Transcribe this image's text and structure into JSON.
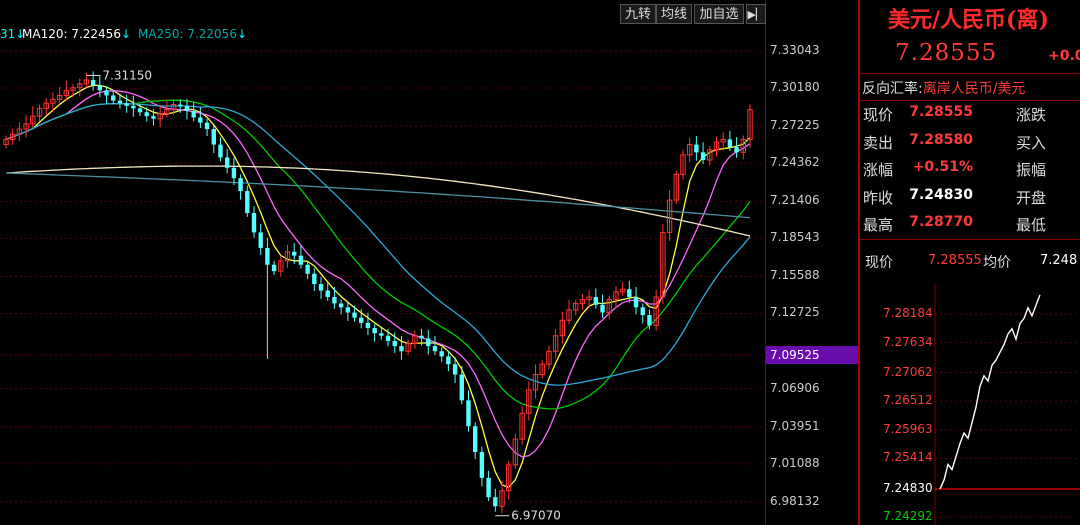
{
  "toolbar": {
    "nine_turn_label": "九转",
    "ma_label": "均线",
    "add_watch_label": "加自选",
    "collapse_icon": "right-collapse-icon"
  },
  "ma_legend": {
    "ma_partial_prefix": "31",
    "ma_partial_arrow": "↓",
    "ma120_label": "MA120: 7.22456",
    "ma120_arrow": "↓",
    "ma250_label": "MA250: 7.22056",
    "ma250_arrow": "↓",
    "colors": {
      "ma_partial": "#00ffff",
      "ma120": "#ffffff",
      "ma250": "#00aaaa"
    }
  },
  "axis": {
    "price_levels": [
      "7.33043",
      "7.30180",
      "7.27225",
      "7.24362",
      "7.21406",
      "7.18543",
      "7.15588",
      "7.12725",
      "7.09525",
      "7.06906",
      "7.03951",
      "7.01088",
      "6.98132"
    ],
    "highlight_level": "7.09525",
    "highlight_color": "#6a0dad"
  },
  "annotations": {
    "high": "7.31150",
    "low": "6.97070"
  },
  "quote": {
    "title": "美元/人民币(离)",
    "price": "7.28555",
    "change": "+0.0",
    "reverse_rate_label": "反向汇率:",
    "reverse_rate_value": "离岸人民币/美元",
    "rows": [
      {
        "label": "现价",
        "value": "7.28555",
        "label2": "涨跌",
        "white": false
      },
      {
        "label": "卖出",
        "value": "7.28580",
        "label2": "买入",
        "white": false
      },
      {
        "label": "涨幅",
        "value": "+0.51%",
        "label2": "振幅",
        "white": false
      },
      {
        "label": "昨收",
        "value": "7.24830",
        "label2": "开盘",
        "white": true
      },
      {
        "label": "最高",
        "value": "7.28770",
        "label2": "最低",
        "white": false
      }
    ]
  },
  "intraday": {
    "price_label": "现价",
    "price_value": "7.28555",
    "avg_label": "均价",
    "avg_value": "7.248",
    "levels": [
      "7.28184",
      "7.27634",
      "7.27062",
      "7.26512",
      "7.25963",
      "7.25414",
      "7.24830",
      "7.24292"
    ],
    "prev_close_level": "7.24830",
    "colors": {
      "up": "#ff3a3a",
      "flat": "#ffffff",
      "down": "#00cc00"
    }
  },
  "chart_data": {
    "type": "candlestick",
    "title": "",
    "series_names": [
      "MA120",
      "MA250"
    ],
    "ylim": [
      6.97,
      7.335
    ],
    "high_marker": 7.3115,
    "low_marker": 6.9707,
    "current_price": 7.28555,
    "highlight_price": 7.09525
  }
}
